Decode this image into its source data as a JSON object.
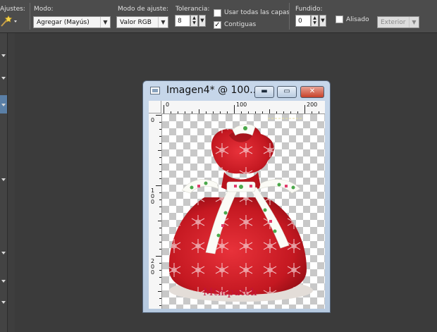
{
  "toolbar": {
    "ajustes_label": "Ajustes:",
    "modo_label": "Modo:",
    "modo_value": "Agregar (Mayús)",
    "modo_ajuste_label": "Modo de ajuste:",
    "modo_ajuste_value": "Valor RGB",
    "tolerancia_label": "Tolerancia:",
    "tolerancia_value": "8",
    "usar_capas_label": "Usar todas las capas",
    "usar_capas_checked": false,
    "contiguas_label": "Contiguas",
    "contiguas_checked": true,
    "fundido_label": "Fundido:",
    "fundido_value": "0",
    "alisado_label": "Alisado",
    "alisado_checked": false,
    "exterior_value": "Exterior",
    "tool_icon": "magic-wand-icon"
  },
  "image_window": {
    "title": "Imagen4* @ 100...",
    "ruler_top": [
      "0",
      "100",
      "200"
    ],
    "ruler_left": [
      "0",
      "100",
      "200"
    ],
    "watermark": "Mtmpatch"
  }
}
